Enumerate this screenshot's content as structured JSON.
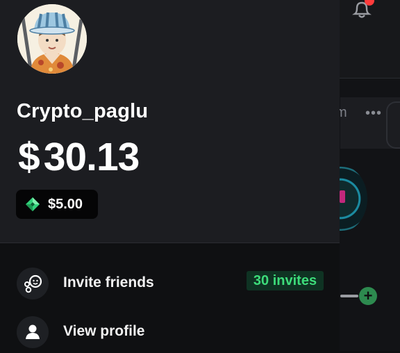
{
  "user": {
    "username": "Crypto_paglu",
    "balance_currency": "$",
    "balance_amount": "30.13",
    "bonus_amount": "$5.00"
  },
  "menu": {
    "items": [
      {
        "label": "Invite friends",
        "icon": "invite-friends-icon",
        "badge": "30 invites"
      },
      {
        "label": "View profile",
        "icon": "user-icon"
      }
    ]
  },
  "background": {
    "tab_fragment": "m",
    "more": "•••",
    "plus": "+"
  },
  "colors": {
    "drawer_header": "#1c1d21",
    "accent_green": "#3ddc7a",
    "badge_bg": "#0f3323",
    "notification": "#ff3b3b"
  }
}
